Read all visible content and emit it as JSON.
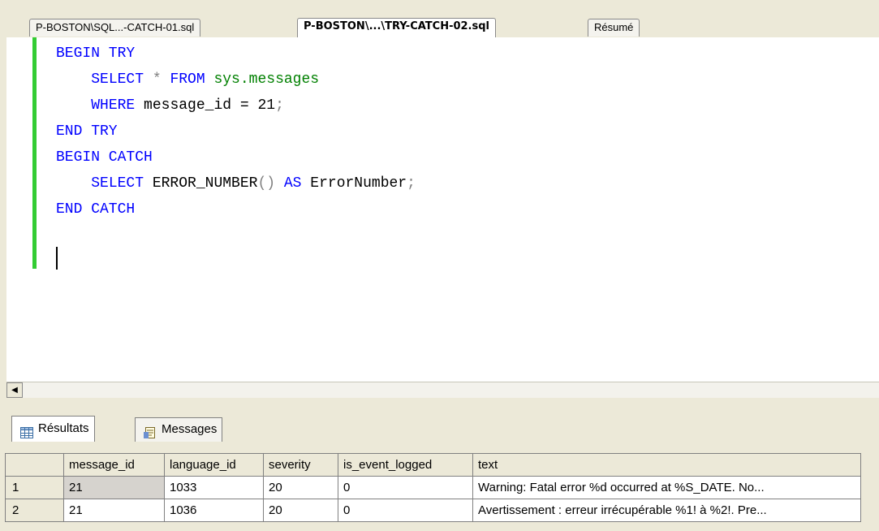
{
  "tabs": [
    {
      "label": "P-BOSTON\\SQL...-CATCH-01.sql"
    },
    {
      "label": "P-BOSTON\\...\\TRY-CATCH-02.sql"
    },
    {
      "label": "Résumé"
    }
  ],
  "code": {
    "line1_kw": "BEGIN TRY",
    "line2_kw": "SELECT",
    "line2_op": " * ",
    "line2_kw2": "FROM",
    "line2_obj": " sys.messages",
    "line3_kw": "WHERE",
    "line3_rest": " message_id = 21",
    "line3_end": ";",
    "line4_kw": "END TRY",
    "line5_kw": "BEGIN CATCH",
    "line6_kw": "SELECT",
    "line6_fn": " ERROR_NUMBER",
    "line6_paren": "()",
    "line6_kw2": " AS",
    "line6_alias": " ErrorNumber",
    "line6_end": ";",
    "line7_kw": "END CATCH"
  },
  "results": {
    "tabs": [
      "Résultats",
      "Messages"
    ],
    "columns": [
      "message_id",
      "language_id",
      "severity",
      "is_event_logged",
      "text"
    ],
    "rows": [
      {
        "num": "1",
        "cells": [
          "21",
          "1033",
          "20",
          "0",
          "Warning: Fatal error %d occurred at %S_DATE. No..."
        ]
      },
      {
        "num": "2",
        "cells": [
          "21",
          "1036",
          "20",
          "0",
          "Avertissement : erreur irrécupérable %1! à %2!. Pre..."
        ]
      }
    ]
  }
}
